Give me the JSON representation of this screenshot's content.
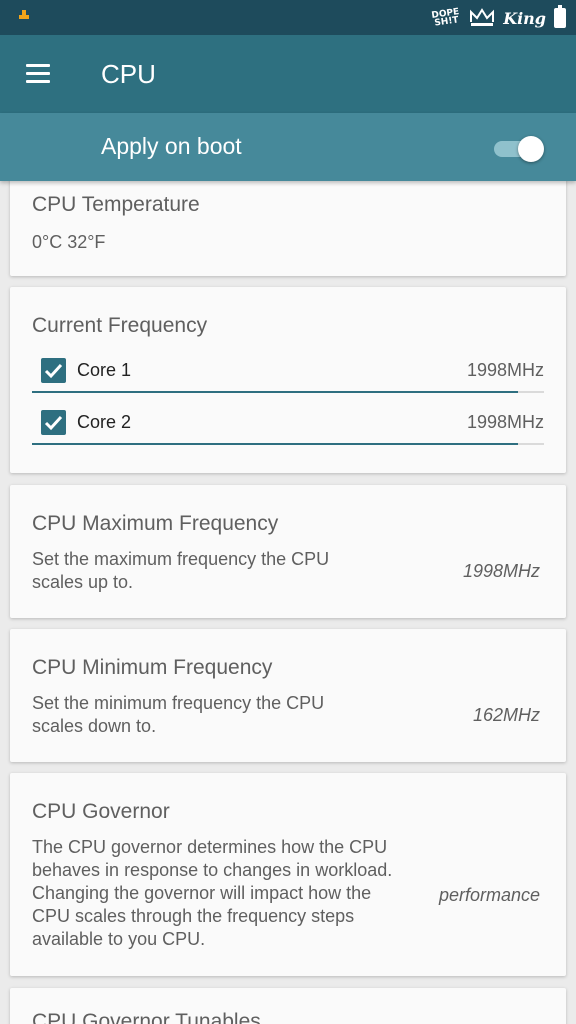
{
  "statusbar": {
    "icons": [
      "notification-icon",
      "dope-icon",
      "crown-icon",
      "king-icon",
      "battery-icon"
    ],
    "dope_text": "DOPE SH!T",
    "king_text": "King"
  },
  "appbar": {
    "title": "CPU",
    "menu_icon": "hamburger-menu-icon"
  },
  "boot": {
    "label": "Apply on boot",
    "enabled": true
  },
  "temperature": {
    "title": "CPU Temperature",
    "value": "0°C 32°F"
  },
  "current_frequency": {
    "title": "Current Frequency",
    "cores": [
      {
        "label": "Core 1",
        "freq": "1998MHz",
        "checked": true,
        "level": 0.95
      },
      {
        "label": "Core 2",
        "freq": "1998MHz",
        "checked": true,
        "level": 0.95
      }
    ]
  },
  "max_frequency": {
    "title": "CPU Maximum Frequency",
    "description": "Set the maximum frequency the CPU scales up to.",
    "value": "1998MHz"
  },
  "min_frequency": {
    "title": "CPU Minimum Frequency",
    "description": "Set the minimum frequency the CPU scales down to.",
    "value": "162MHz"
  },
  "governor": {
    "title": "CPU Governor",
    "description": "The CPU governor determines how the CPU behaves in response to changes in workload. Changing the governor will impact how the CPU scales through the frequency steps available to you CPU.",
    "value": "performance"
  },
  "governor_tunables": {
    "title": "CPU Governor Tunables"
  },
  "colors": {
    "statusbar": "#1e4b5c",
    "appbar": "#2e7080",
    "bootbar": "#46899a",
    "accent": "#2e6f80"
  }
}
